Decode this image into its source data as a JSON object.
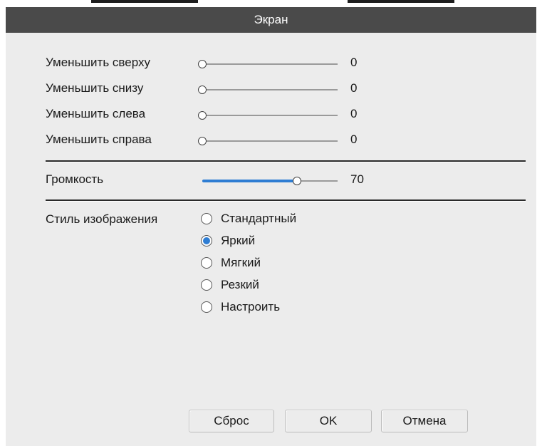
{
  "dialog": {
    "title": "Экран"
  },
  "margins": [
    {
      "label": "Уменьшить сверху",
      "value": "0",
      "level": 0
    },
    {
      "label": "Уменьшить снизу",
      "value": "0",
      "level": 0
    },
    {
      "label": "Уменьшить слева",
      "value": "0",
      "level": 0
    },
    {
      "label": "Уменьшить справа",
      "value": "0",
      "level": 0
    }
  ],
  "volume": {
    "label": "Громкость",
    "value": "70",
    "level": 0.7
  },
  "image_style": {
    "label": "Стиль изображения",
    "options": [
      {
        "label": "Стандартный",
        "checked": false
      },
      {
        "label": "Яркий",
        "checked": true
      },
      {
        "label": "Мягкий",
        "checked": false
      },
      {
        "label": "Резкий",
        "checked": false
      },
      {
        "label": "Настроить",
        "checked": false
      }
    ]
  },
  "buttons": {
    "reset": "Сброс",
    "ok": "OK",
    "cancel": "Отмена"
  },
  "colors": {
    "titlebar": "#4a4a4a",
    "panel": "#ececec",
    "accent": "#2e7dd3"
  }
}
